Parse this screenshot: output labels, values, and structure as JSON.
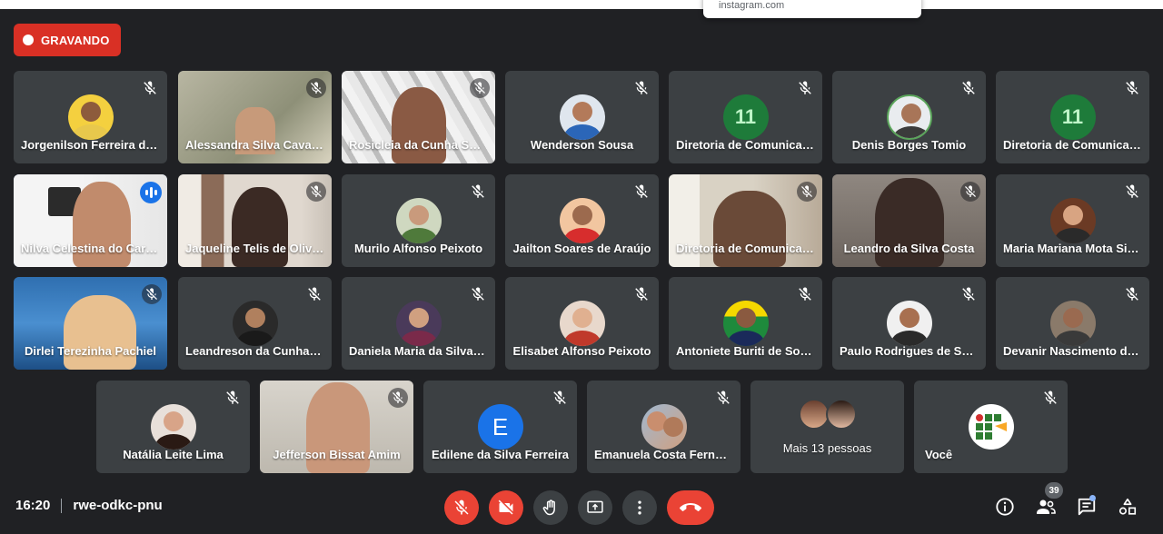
{
  "tooltip": {
    "text": "instagram.com"
  },
  "recording": {
    "label": "GRAVANDO"
  },
  "colors": {
    "background": "#202124",
    "tile": "#3c4043",
    "danger": "#ea4335",
    "accent": "#1a73e8",
    "speaking_outline": "#8ab4f8"
  },
  "participants": [
    {
      "name": "Jorgenilson Ferreira de Souza",
      "type": "avatar",
      "muted": true
    },
    {
      "name": "Alessandra Silva Cavalcante",
      "type": "video",
      "muted": true
    },
    {
      "name": "Rosicleia da Cunha Souza",
      "type": "video",
      "muted": true
    },
    {
      "name": "Wenderson Sousa",
      "type": "avatar",
      "muted": true
    },
    {
      "name": "Diretoria de Comunicação",
      "type": "logo",
      "logo_text": "11",
      "muted": true
    },
    {
      "name": "Denis Borges Tomio",
      "type": "avatar",
      "muted": true
    },
    {
      "name": "Diretoria de Comunicação",
      "type": "logo",
      "logo_text": "11",
      "muted": true
    },
    {
      "name": "Nilva Celestina do Carmo",
      "type": "video",
      "muted": false,
      "speaking": true
    },
    {
      "name": "Jaqueline Telis de Oliveira",
      "type": "video",
      "muted": true
    },
    {
      "name": "Murilo Alfonso Peixoto",
      "type": "avatar",
      "muted": true
    },
    {
      "name": "Jailton Soares de Araújo",
      "type": "avatar",
      "muted": true
    },
    {
      "name": "Diretoria de Comunicação",
      "type": "video",
      "muted": true
    },
    {
      "name": "Leandro da Silva Costa",
      "type": "video",
      "muted": true
    },
    {
      "name": "Maria Mariana Mota Silva",
      "type": "avatar",
      "muted": true
    },
    {
      "name": "Dirlei Terezinha Pachiel",
      "type": "video",
      "muted": true
    },
    {
      "name": "Leandreson da Cunha Silva",
      "type": "avatar",
      "muted": true
    },
    {
      "name": "Daniela Maria da Silva Sousa",
      "type": "avatar",
      "muted": true
    },
    {
      "name": "Elisabet Alfonso Peixoto",
      "type": "avatar",
      "muted": true
    },
    {
      "name": "Antoniete Buriti de Souza",
      "type": "avatar",
      "muted": true
    },
    {
      "name": "Paulo Rodrigues de Souza",
      "type": "avatar",
      "muted": true
    },
    {
      "name": "Devanir Nascimento da Silva",
      "type": "avatar",
      "muted": true
    },
    {
      "name": "Natália Leite Lima",
      "type": "avatar",
      "muted": true
    },
    {
      "name": "Jefferson Bissat Amim",
      "type": "video",
      "muted": true
    },
    {
      "name": "Edilene da Silva Ferreira",
      "type": "letter",
      "letter": "E",
      "muted": true
    },
    {
      "name": "Emanuela Costa Fernandes",
      "type": "avatar",
      "muted": true
    },
    {
      "name": "Mais 13 pessoas",
      "type": "more"
    },
    {
      "name": "Você",
      "type": "logo-if",
      "muted": true
    }
  ],
  "meeting": {
    "time": "16:20",
    "code": "rwe-odkc-pnu"
  },
  "controls": {
    "mic": "mic-off-icon",
    "camera": "camera-off-icon",
    "hand": "raise-hand-icon",
    "present": "present-screen-icon",
    "more": "more-options-icon",
    "hangup": "hang-up-icon"
  },
  "side": {
    "people_count": "39"
  }
}
